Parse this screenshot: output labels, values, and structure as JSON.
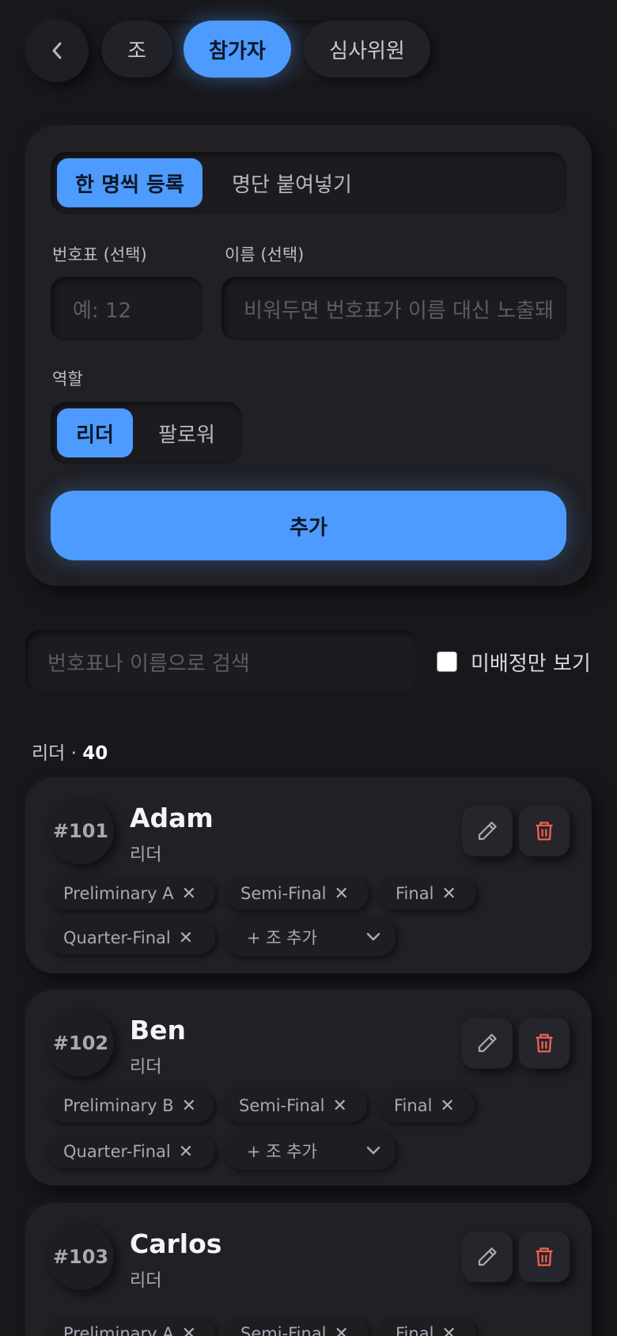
{
  "nav": {
    "tabs": [
      {
        "label": "조"
      },
      {
        "label": "참가자"
      },
      {
        "label": "심사위원"
      }
    ]
  },
  "form": {
    "modes": [
      "한 명씩 등록",
      "명단 붙여넣기"
    ],
    "bib_label": "번호표 (선택)",
    "bib_placeholder": "예: 12",
    "name_label": "이름 (선택)",
    "name_placeholder": "비워두면 번호표가 이름 대신 노출돼",
    "role_label": "역할",
    "roles": [
      "리더",
      "팔로워"
    ],
    "add_label": "추가"
  },
  "filter": {
    "search_placeholder": "번호표나 이름으로 검색",
    "unassigned_label": "미배정만 보기"
  },
  "section": {
    "role": "리더 · ",
    "count": "40"
  },
  "participants": [
    {
      "bib": "#101",
      "name": "Adam",
      "role": "리더",
      "groups": [
        "Preliminary A",
        "Semi-Final",
        "Final",
        "Quarter-Final"
      ],
      "add_group": "+ 조 추가"
    },
    {
      "bib": "#102",
      "name": "Ben",
      "role": "리더",
      "groups": [
        "Preliminary B",
        "Semi-Final",
        "Final",
        "Quarter-Final"
      ],
      "add_group": "+ 조 추가"
    },
    {
      "bib": "#103",
      "name": "Carlos",
      "role": "리더",
      "groups": [
        "Preliminary A",
        "Semi-Final",
        "Final"
      ]
    }
  ],
  "colors": {
    "accent": "#4d9bff",
    "danger": "#f0604e",
    "background": "#18181c"
  }
}
